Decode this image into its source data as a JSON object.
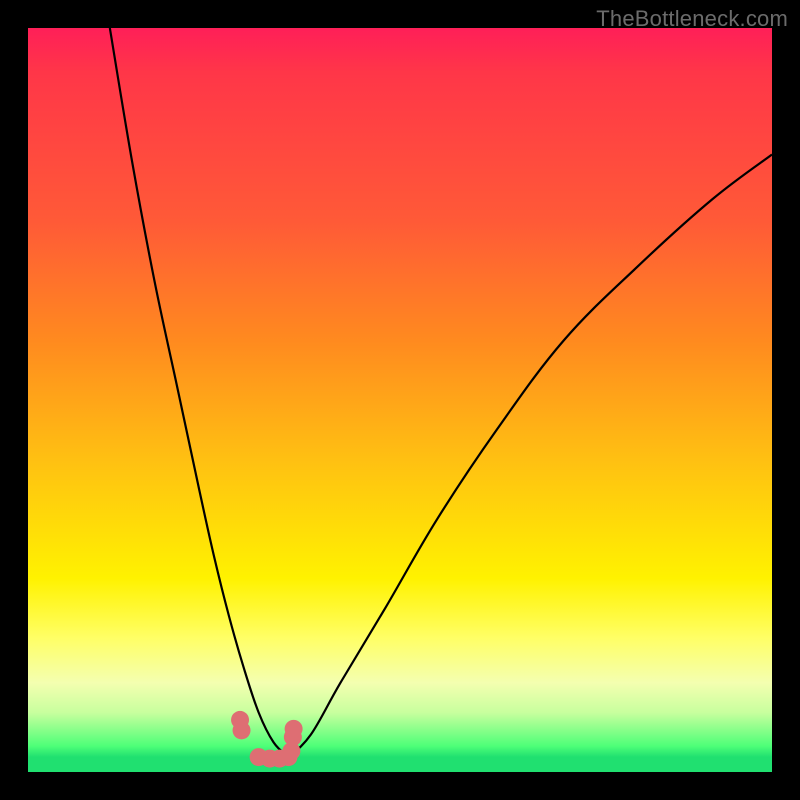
{
  "watermark": "TheBottleneck.com",
  "chart_data": {
    "type": "line",
    "title": "",
    "xlabel": "",
    "ylabel": "",
    "xlim": [
      0,
      100
    ],
    "ylim": [
      0,
      100
    ],
    "grid": false,
    "series": [
      {
        "name": "left-curve",
        "x": [
          11,
          14,
          17,
          20,
          23,
          25,
          27,
          29,
          31,
          33,
          35
        ],
        "y": [
          100,
          82,
          66,
          52,
          38,
          29,
          21,
          14,
          8,
          4,
          2
        ]
      },
      {
        "name": "right-curve",
        "x": [
          35,
          38,
          42,
          48,
          55,
          63,
          72,
          82,
          92,
          100
        ],
        "y": [
          2,
          5,
          12,
          22,
          34,
          46,
          58,
          68,
          77,
          83
        ]
      },
      {
        "name": "trough-dots",
        "x": [
          28.5,
          28.7,
          31.0,
          32.5,
          33.8,
          35.0,
          35.4,
          35.6,
          35.7
        ],
        "y": [
          7.0,
          5.6,
          2.0,
          1.8,
          1.8,
          2.0,
          2.8,
          4.7,
          5.8
        ]
      }
    ],
    "colors": {
      "curve": "#000000",
      "dots": "#de6e73"
    }
  }
}
